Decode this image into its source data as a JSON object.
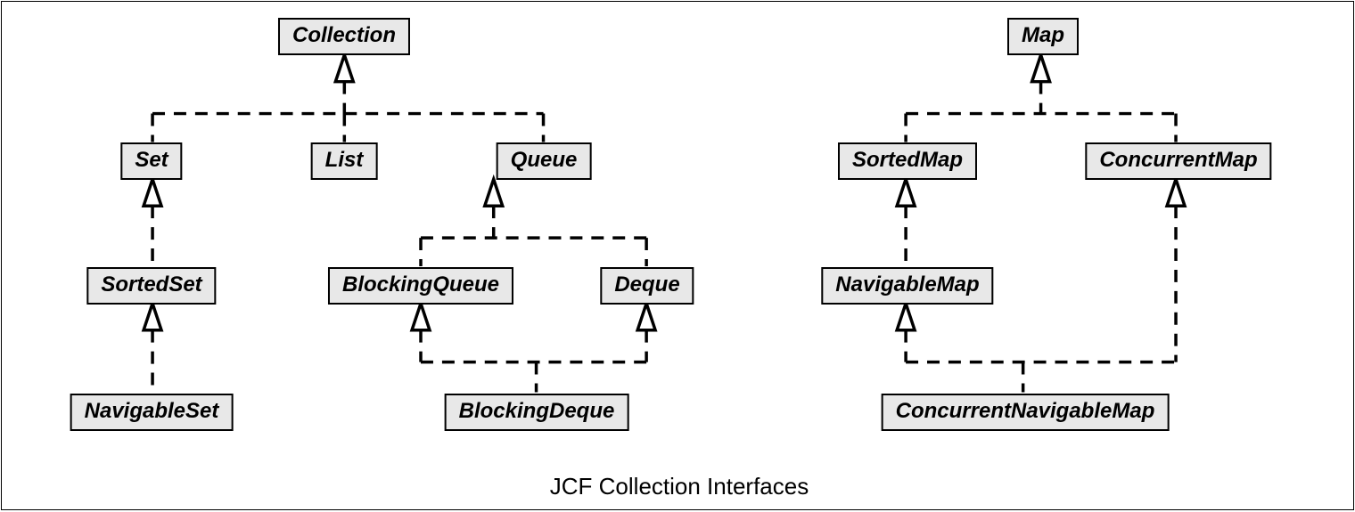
{
  "caption": "JCF Collection Interfaces",
  "nodes": {
    "collection": "Collection",
    "set": "Set",
    "list": "List",
    "queue": "Queue",
    "sortedSet": "SortedSet",
    "blockingQueue": "BlockingQueue",
    "deque": "Deque",
    "navigableSet": "NavigableSet",
    "blockingDeque": "BlockingDeque",
    "map": "Map",
    "sortedMap": "SortedMap",
    "concurrentMap": "ConcurrentMap",
    "navigableMap": "NavigableMap",
    "concurrentNavigableMap": "ConcurrentNavigableMap"
  }
}
